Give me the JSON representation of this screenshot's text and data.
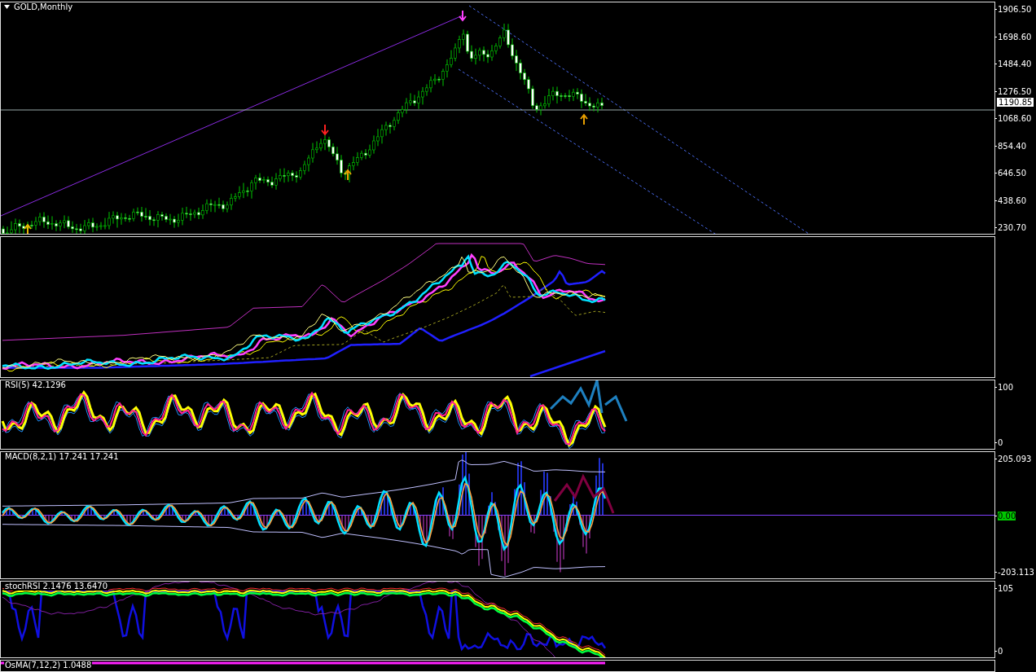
{
  "chart": {
    "title": "GOLD,Monthly",
    "price_axis": [
      "1906.50",
      "1698.60",
      "1484.40",
      "1276.50",
      "1068.60",
      "854.40",
      "646.50",
      "438.60",
      "230.70"
    ],
    "current_price": "1190.85"
  },
  "indicators": [
    {
      "kind": "ma"
    },
    {
      "kind": "rsi",
      "label": "RSI(5) 42.1296",
      "axis": [
        "100",
        "0"
      ]
    },
    {
      "kind": "macd",
      "label": "MACD(8,2,1) 17.241 17.241",
      "axis": [
        "205.093",
        "0.00",
        "-203.113"
      ]
    },
    {
      "kind": "stoch",
      "label": "stochRSI 2.1476 13.6470",
      "axis": [
        "105",
        "0"
      ]
    },
    {
      "kind": "osma",
      "label": "OsMA(7,12,2) 1.0488"
    }
  ]
}
